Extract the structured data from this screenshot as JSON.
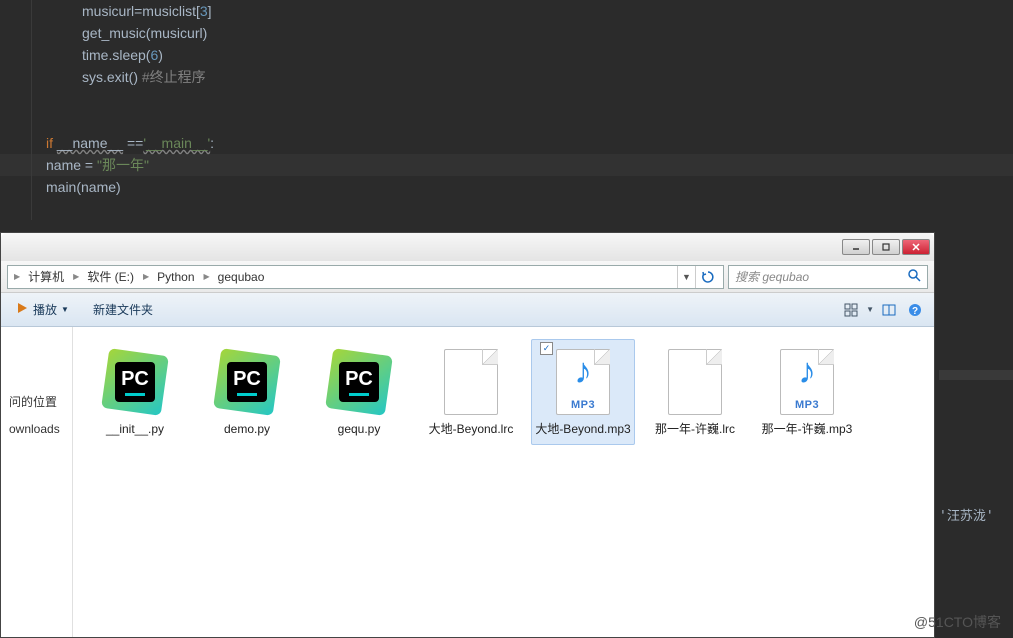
{
  "code": {
    "lines": {
      "l1_a": "musicurl=musiclist[",
      "l1_num": "3",
      "l1_b": "]",
      "l2": "get_music(musicurl)",
      "l3_a": "time.sleep(",
      "l3_num": "6",
      "l3_b": ")",
      "l4_a": "sys.exit()",
      "l4_cmt": " #终止程序",
      "l7_if": "if ",
      "l7_name1": "__name__",
      "l7_eq": " ==",
      "l7_str": "'__main__'",
      "l7_colon": ":",
      "l8_a": "name = ",
      "l8_str": "\"那一年\"",
      "l9_a": "main(",
      "l9_var": "name",
      "l9_b": ")"
    }
  },
  "explorer": {
    "breadcrumbs": [
      "计算机",
      "软件 (E:)",
      "Python",
      "gequbao"
    ],
    "search_placeholder": "搜索 gequbao",
    "toolbar": {
      "play": "播放",
      "newfolder": "新建文件夹"
    }
  },
  "sidebar": {
    "item1": "问的位置",
    "item2": "ownloads"
  },
  "files": [
    {
      "name": "__init__.py",
      "type": "py"
    },
    {
      "name": "demo.py",
      "type": "py"
    },
    {
      "name": "gequ.py",
      "type": "py"
    },
    {
      "name": "大地-Beyond.lrc",
      "type": "lrc"
    },
    {
      "name": "大地-Beyond.mp3",
      "type": "mp3",
      "selected": true,
      "checked": true
    },
    {
      "name": "那一年-许巍.lrc",
      "type": "lrc"
    },
    {
      "name": "那一年-许巍.mp3",
      "type": "mp3"
    }
  ],
  "ext_labels": {
    "mp3": "MP3"
  },
  "dark_panel_text": "'汪苏泷'",
  "watermark": "@51CTO博客"
}
